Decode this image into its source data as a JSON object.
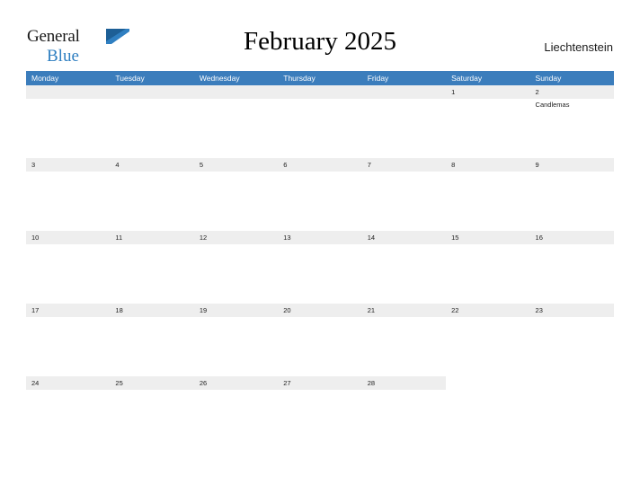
{
  "brand": {
    "name_part1": "General",
    "name_part2": "Blue",
    "flag_icon": "flag-icon"
  },
  "header": {
    "title": "February 2025",
    "country": "Liechtenstein"
  },
  "colors": {
    "header_blue": "#3b7dbc",
    "shade_gray": "#eeeeee",
    "brand_blue": "#2f7fc1"
  },
  "calendar": {
    "day_headers": [
      "Monday",
      "Tuesday",
      "Wednesday",
      "Thursday",
      "Friday",
      "Saturday",
      "Sunday"
    ],
    "weeks": [
      [
        {
          "day": "",
          "event": ""
        },
        {
          "day": "",
          "event": ""
        },
        {
          "day": "",
          "event": ""
        },
        {
          "day": "",
          "event": ""
        },
        {
          "day": "",
          "event": ""
        },
        {
          "day": "1",
          "event": ""
        },
        {
          "day": "2",
          "event": "Candlemas"
        }
      ],
      [
        {
          "day": "3",
          "event": ""
        },
        {
          "day": "4",
          "event": ""
        },
        {
          "day": "5",
          "event": ""
        },
        {
          "day": "6",
          "event": ""
        },
        {
          "day": "7",
          "event": ""
        },
        {
          "day": "8",
          "event": ""
        },
        {
          "day": "9",
          "event": ""
        }
      ],
      [
        {
          "day": "10",
          "event": ""
        },
        {
          "day": "11",
          "event": ""
        },
        {
          "day": "12",
          "event": ""
        },
        {
          "day": "13",
          "event": ""
        },
        {
          "day": "14",
          "event": ""
        },
        {
          "day": "15",
          "event": ""
        },
        {
          "day": "16",
          "event": ""
        }
      ],
      [
        {
          "day": "17",
          "event": ""
        },
        {
          "day": "18",
          "event": ""
        },
        {
          "day": "19",
          "event": ""
        },
        {
          "day": "20",
          "event": ""
        },
        {
          "day": "21",
          "event": ""
        },
        {
          "day": "22",
          "event": ""
        },
        {
          "day": "23",
          "event": ""
        }
      ],
      [
        {
          "day": "24",
          "event": ""
        },
        {
          "day": "25",
          "event": ""
        },
        {
          "day": "26",
          "event": ""
        },
        {
          "day": "27",
          "event": ""
        },
        {
          "day": "28",
          "event": ""
        },
        {
          "day": "",
          "event": ""
        },
        {
          "day": "",
          "event": ""
        }
      ]
    ]
  }
}
